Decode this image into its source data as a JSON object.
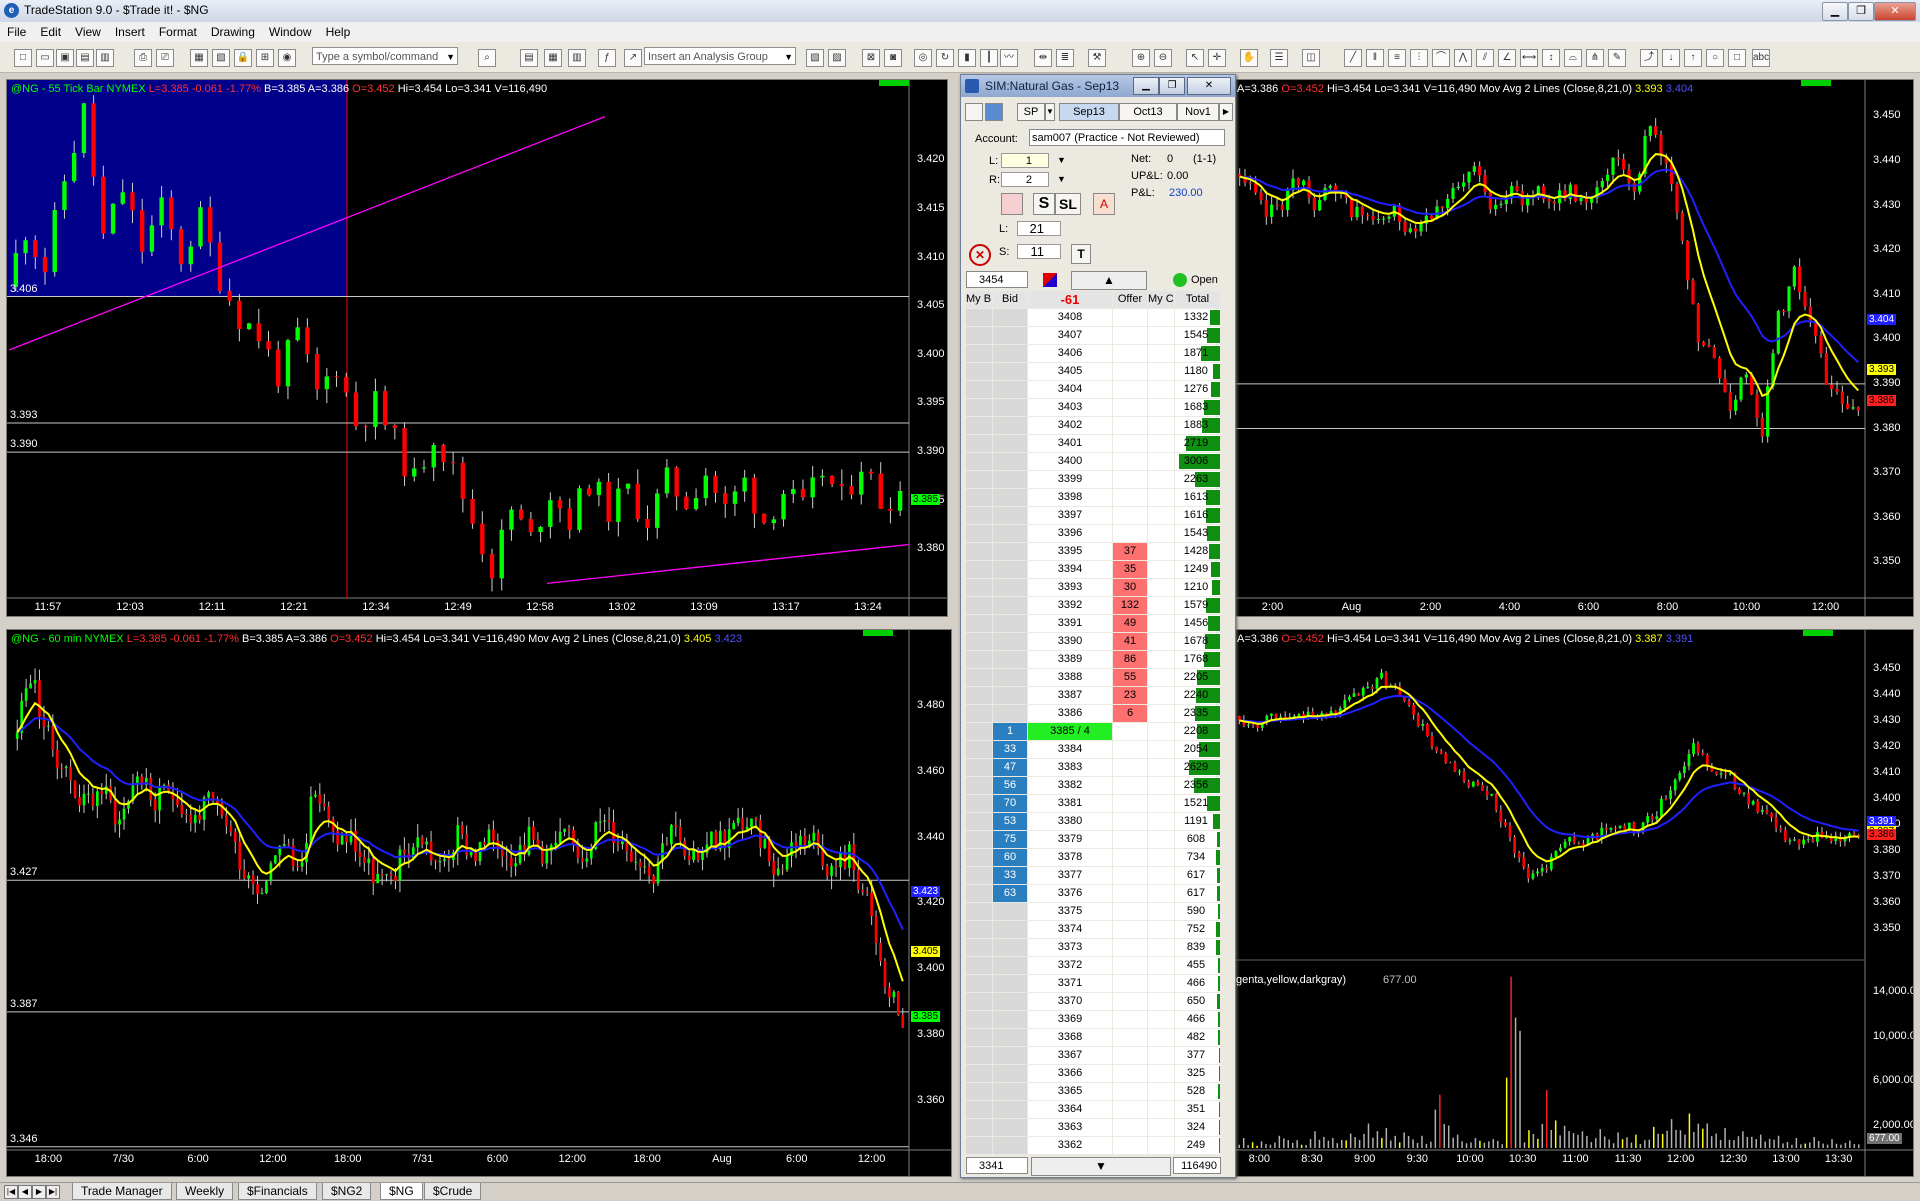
{
  "window": {
    "title": "TradeStation 9.0 - $Trade it! - $NG",
    "logo": "e"
  },
  "menu": [
    "File",
    "Edit",
    "View",
    "Insert",
    "Format",
    "Drawing",
    "Window",
    "Help"
  ],
  "toolbar": {
    "symbol_placeholder": "Type a symbol/command",
    "analysis_placeholder": "Insert an Analysis Group"
  },
  "colors": {
    "up": "#00ff00",
    "down": "#ff0000",
    "ma_fast": "#ffff00",
    "ma_slow": "#2020ff",
    "trend": "#ff00ff",
    "selection": "#00008b"
  },
  "chart_tick": {
    "header": {
      "sym": "@NG - 55 Tick Bar  NYMEX",
      "last": "L=3.385",
      "chg": "-0.061",
      "pct": "-1.77%",
      "bid": "B=3.385",
      "ask": "A=3.386",
      "open": "O=3.452",
      "hi": "Hi=3.454",
      "lo": "Lo=3.341",
      "vol": "V=116,490"
    },
    "hlines": [
      {
        "label": "3.406",
        "v": 3.406
      },
      {
        "label": "3.393",
        "v": 3.393
      },
      {
        "label": "3.390",
        "v": 3.39
      }
    ],
    "last_tag": "3.385",
    "chart_data": {
      "type": "candlestick",
      "ylim": [
        3.375,
        3.426
      ],
      "yticks": [
        "3.420",
        "3.415",
        "3.410",
        "3.405",
        "3.400",
        "3.395",
        "3.390",
        "3.385",
        "3.380"
      ],
      "xticks": [
        "11:57",
        "12:03",
        "12:11",
        "12:21",
        "12:34",
        "12:49",
        "12:58",
        "13:02",
        "13:09",
        "13:17",
        "13:24"
      ],
      "path": [
        3.407,
        3.413,
        3.409,
        3.418,
        3.425,
        3.412,
        3.417,
        3.411,
        3.415,
        3.41,
        3.414,
        3.408,
        3.404,
        3.402,
        3.398,
        3.402,
        3.396,
        3.399,
        3.393,
        3.395,
        3.391,
        3.387,
        3.392,
        3.388,
        3.383,
        3.378,
        3.384,
        3.381,
        3.386,
        3.383,
        3.387,
        3.384,
        3.386,
        3.383,
        3.387,
        3.385,
        3.388,
        3.384,
        3.387,
        3.383,
        3.386,
        3.384,
        3.388,
        3.385,
        3.389,
        3.385,
        3.386
      ]
    }
  },
  "chart_60": {
    "header": {
      "sym": "@NG - 60 min  NYMEX",
      "last": "L=3.385",
      "chg": "-0.061",
      "pct": "-1.77%",
      "bid": "B=3.385",
      "ask": "A=3.386",
      "open": "O=3.452",
      "hi": "Hi=3.454",
      "lo": "Lo=3.341",
      "vol": "V=116,490",
      "study": "Mov Avg 2 Lines (Close,8,21,0)",
      "ma1": "3.405",
      "ma2": "3.423"
    },
    "hlines": [
      {
        "label": "3.427",
        "v": 3.427
      },
      {
        "label": "3.387",
        "v": 3.387
      },
      {
        "label": "3.346",
        "v": 3.346
      }
    ],
    "tags": [
      {
        "text": "3.423",
        "v": 3.423,
        "color": "#2020ff"
      },
      {
        "text": "3.405",
        "v": 3.405,
        "color": "#ffff00"
      },
      {
        "text": "3.385",
        "v": 3.385,
        "color": "#00ff00"
      }
    ],
    "chart_data": {
      "type": "candlestick",
      "ylim": [
        3.345,
        3.497
      ],
      "yticks": [
        "3.480",
        "3.460",
        "3.440",
        "3.420",
        "3.400",
        "3.380",
        "3.360"
      ],
      "xticks": [
        "18:00",
        "7/30",
        "6:00",
        "12:00",
        "18:00",
        "7/31",
        "6:00",
        "12:00",
        "18:00",
        "Aug",
        "6:00",
        "12:00"
      ],
      "path": [
        3.47,
        3.49,
        3.47,
        3.46,
        3.45,
        3.455,
        3.445,
        3.46,
        3.45,
        3.455,
        3.445,
        3.45,
        3.445,
        3.43,
        3.425,
        3.44,
        3.43,
        3.455,
        3.44,
        3.44,
        3.43,
        3.425,
        3.435,
        3.44,
        3.43,
        3.44,
        3.435,
        3.44,
        3.435,
        3.44,
        3.435,
        3.44,
        3.435,
        3.445,
        3.44,
        3.435,
        3.43,
        3.445,
        3.43,
        3.44,
        3.44,
        3.445,
        3.44,
        3.43,
        3.44,
        3.44,
        3.43,
        3.435,
        3.42,
        3.395,
        3.385
      ]
    }
  },
  "chart_top_right": {
    "header": {
      "ask": "A=3.386",
      "open": "O=3.452",
      "hi": "Hi=3.454",
      "lo": "Lo=3.341",
      "vol": "V=116,490",
      "study": "Mov Avg 2 Lines (Close,8,21,0)",
      "ma1": "3.393",
      "ma2": "3.404"
    },
    "hlines": [
      {
        "v": 3.39
      },
      {
        "v": 3.38
      }
    ],
    "tags": [
      {
        "text": "3.404",
        "v": 3.404,
        "color": "#2020ff"
      },
      {
        "text": "3.393",
        "v": 3.393,
        "color": "#ffff00"
      },
      {
        "text": "3.386",
        "v": 3.386,
        "color": "#ff2020"
      }
    ],
    "chart_data": {
      "type": "candlestick",
      "ylim": [
        3.342,
        3.455
      ],
      "yticks": [
        "3.450",
        "3.440",
        "3.430",
        "3.420",
        "3.410",
        "3.400",
        "3.390",
        "3.380",
        "3.370",
        "3.360",
        "3.350"
      ],
      "xticks": [
        "2:00",
        "Aug",
        "2:00",
        "4:00",
        "6:00",
        "8:00",
        "10:00",
        "12:00"
      ],
      "path": [
        3.437,
        3.433,
        3.428,
        3.431,
        3.436,
        3.431,
        3.433,
        3.43,
        3.428,
        3.426,
        3.428,
        3.425,
        3.428,
        3.431,
        3.433,
        3.438,
        3.431,
        3.433,
        3.431,
        3.434,
        3.431,
        3.433,
        3.431,
        3.437,
        3.441,
        3.434,
        3.449,
        3.44,
        3.42,
        3.4,
        3.395,
        3.385,
        3.393,
        3.38,
        3.405,
        3.415,
        3.405,
        3.39,
        3.385,
        3.386
      ]
    }
  },
  "chart_bottom_right": {
    "header": {
      "ask": "A=3.386",
      "open": "O=3.452",
      "hi": "Hi=3.454",
      "lo": "Lo=3.341",
      "vol": "V=116,490",
      "study": "Mov Avg 2 Lines (Close,8,21,0)",
      "ma1": "3.387",
      "ma2": "3.391"
    },
    "vol_label": "genta,yellow,darkgray)",
    "vol_value": "677.00",
    "vol_tag": "677.00",
    "tags": [
      {
        "text": "3.391",
        "v": 3.391,
        "color": "#2020ff"
      },
      {
        "text": "3.387",
        "v": 3.387,
        "color": "#ffff00"
      },
      {
        "text": "3.386",
        "v": 3.386,
        "color": "#ff2020"
      }
    ],
    "chart_data": {
      "type": "candlestick",
      "ylim": [
        3.342,
        3.455
      ],
      "yticks": [
        "3.450",
        "3.440",
        "3.430",
        "3.420",
        "3.410",
        "3.400",
        "3.390",
        "3.380",
        "3.370",
        "3.360",
        "3.350"
      ],
      "vticks": [
        "14,000.00",
        "10,000.00",
        "6,000.00",
        "2,000.00"
      ],
      "vlim": [
        0,
        16000
      ],
      "xticks": [
        "8:00",
        "8:30",
        "9:00",
        "9:30",
        "10:00",
        "10:30",
        "11:00",
        "11:30",
        "12:00",
        "12:30",
        "13:00",
        "13:30"
      ],
      "path": [
        3.432,
        3.428,
        3.433,
        3.43,
        3.434,
        3.431,
        3.437,
        3.441,
        3.447,
        3.44,
        3.43,
        3.418,
        3.41,
        3.405,
        3.4,
        3.385,
        3.37,
        3.375,
        3.385,
        3.382,
        3.388,
        3.39,
        3.388,
        3.395,
        3.408,
        3.42,
        3.412,
        3.408,
        3.4,
        3.393,
        3.385,
        3.383,
        3.386,
        3.385,
        3.386
      ],
      "volume": [
        900,
        600,
        1100,
        700,
        1500,
        900,
        1300,
        2200,
        1800,
        1400,
        1100,
        4800,
        1200,
        900,
        800,
        15400,
        1600,
        5200,
        2000,
        1500,
        1700,
        1400,
        1200,
        1900,
        2600,
        3100,
        2200,
        1800,
        1500,
        1200,
        1100,
        900,
        1000,
        800,
        677
      ]
    }
  },
  "trade": {
    "title": "SIM:Natural Gas - Sep13",
    "tb": {
      "sp": "SP",
      "m1": "Sep13",
      "m2": "Oct13",
      "m3": "Nov1"
    },
    "account_label": "Account:",
    "account": "sam007 (Practice - Not Reviewed)",
    "l_label": "L:",
    "l_val": "1",
    "r_label": "R:",
    "r_val": "2",
    "net_label": "Net:",
    "net": "0",
    "net_x": "(1-1)",
    "upl_label": "UP&L:",
    "upl": "0.00",
    "pl_label": "P&L:",
    "pl": "230.00",
    "btn_s": "S",
    "btn_sl": "SL",
    "l2_label": "L:",
    "l2_val": "21",
    "s_label": "S:",
    "s_val": "11",
    "btn_t": "T",
    "field_price": "3454",
    "status": "Open",
    "cols": {
      "mybid": "My B",
      "bid": "Bid",
      "net_change": "-61",
      "offer": "Offer",
      "myoffer": "My C",
      "total": "Total"
    },
    "footer": {
      "low": "3341",
      "total": "116490"
    },
    "ladder": [
      {
        "p": "3408",
        "t": "1332",
        "f": 0.22
      },
      {
        "p": "3407",
        "t": "1545",
        "f": 0.28
      },
      {
        "p": "3406",
        "t": "1871",
        "f": 0.42
      },
      {
        "p": "3405",
        "t": "1180",
        "f": 0.16
      },
      {
        "p": "3404",
        "t": "1276",
        "f": 0.2
      },
      {
        "p": "3403",
        "t": "1683",
        "f": 0.35
      },
      {
        "p": "3402",
        "t": "1883",
        "f": 0.4
      },
      {
        "p": "3401",
        "t": "2719",
        "f": 0.75
      },
      {
        "p": "3400",
        "t": "3006",
        "f": 0.9
      },
      {
        "p": "3399",
        "t": "2263",
        "f": 0.55
      },
      {
        "p": "3398",
        "t": "1613",
        "f": 0.3
      },
      {
        "p": "3397",
        "t": "1616",
        "f": 0.3
      },
      {
        "p": "3396",
        "t": "1543",
        "f": 0.28
      },
      {
        "p": "3395",
        "o": "37",
        "t": "1428",
        "f": 0.25
      },
      {
        "p": "3394",
        "o": "35",
        "t": "1249",
        "f": 0.2
      },
      {
        "p": "3393",
        "o": "30",
        "t": "1210",
        "f": 0.18
      },
      {
        "p": "3392",
        "o": "132",
        "t": "1579",
        "f": 0.3
      },
      {
        "p": "3391",
        "o": "49",
        "t": "1456",
        "f": 0.26
      },
      {
        "p": "3390",
        "o": "41",
        "t": "1678",
        "f": 0.34
      },
      {
        "p": "3389",
        "o": "86",
        "t": "1768",
        "f": 0.36
      },
      {
        "p": "3388",
        "o": "55",
        "t": "2205",
        "f": 0.52
      },
      {
        "p": "3387",
        "o": "23",
        "t": "2240",
        "f": 0.53
      },
      {
        "p": "3386",
        "o": "6",
        "t": "2335",
        "f": 0.56
      },
      {
        "p": "3385 / 4",
        "b": "1",
        "t": "2208",
        "f": 0.52,
        "last": true
      },
      {
        "p": "3384",
        "b": "33",
        "t": "2054",
        "f": 0.46
      },
      {
        "p": "3383",
        "b": "47",
        "t": "2629",
        "f": 0.7
      },
      {
        "p": "3382",
        "b": "56",
        "t": "2356",
        "f": 0.58
      },
      {
        "p": "3381",
        "b": "70",
        "t": "1521",
        "f": 0.28
      },
      {
        "p": "3380",
        "b": "53",
        "t": "1191",
        "f": 0.16
      },
      {
        "p": "3379",
        "b": "75",
        "t": "608",
        "f": 0.06
      },
      {
        "p": "3378",
        "b": "60",
        "t": "734",
        "f": 0.08
      },
      {
        "p": "3377",
        "b": "33",
        "t": "617",
        "f": 0.06
      },
      {
        "p": "3376",
        "b": "63",
        "t": "617",
        "f": 0.06
      },
      {
        "p": "3375",
        "t": "590",
        "f": 0.05
      },
      {
        "p": "3374",
        "t": "752",
        "f": 0.08
      },
      {
        "p": "3373",
        "t": "839",
        "f": 0.09
      },
      {
        "p": "3372",
        "t": "455",
        "f": 0.04
      },
      {
        "p": "3371",
        "t": "466",
        "f": 0.04
      },
      {
        "p": "3370",
        "t": "650",
        "f": 0.06
      },
      {
        "p": "3369",
        "t": "466",
        "f": 0.04
      },
      {
        "p": "3368",
        "t": "482",
        "f": 0.04
      },
      {
        "p": "3367",
        "t": "377",
        "f": 0.03
      },
      {
        "p": "3366",
        "t": "325",
        "f": 0.03
      },
      {
        "p": "3365",
        "t": "528",
        "f": 0.05
      },
      {
        "p": "3364",
        "t": "351",
        "f": 0.03
      },
      {
        "p": "3363",
        "t": "324",
        "f": 0.03
      },
      {
        "p": "3362",
        "t": "249",
        "f": 0.02
      }
    ]
  },
  "tabs": [
    "Trade Manager",
    "Weekly",
    "$Financials",
    "$NG2",
    "$NG",
    "$Crude"
  ],
  "active_tab": "$NG"
}
